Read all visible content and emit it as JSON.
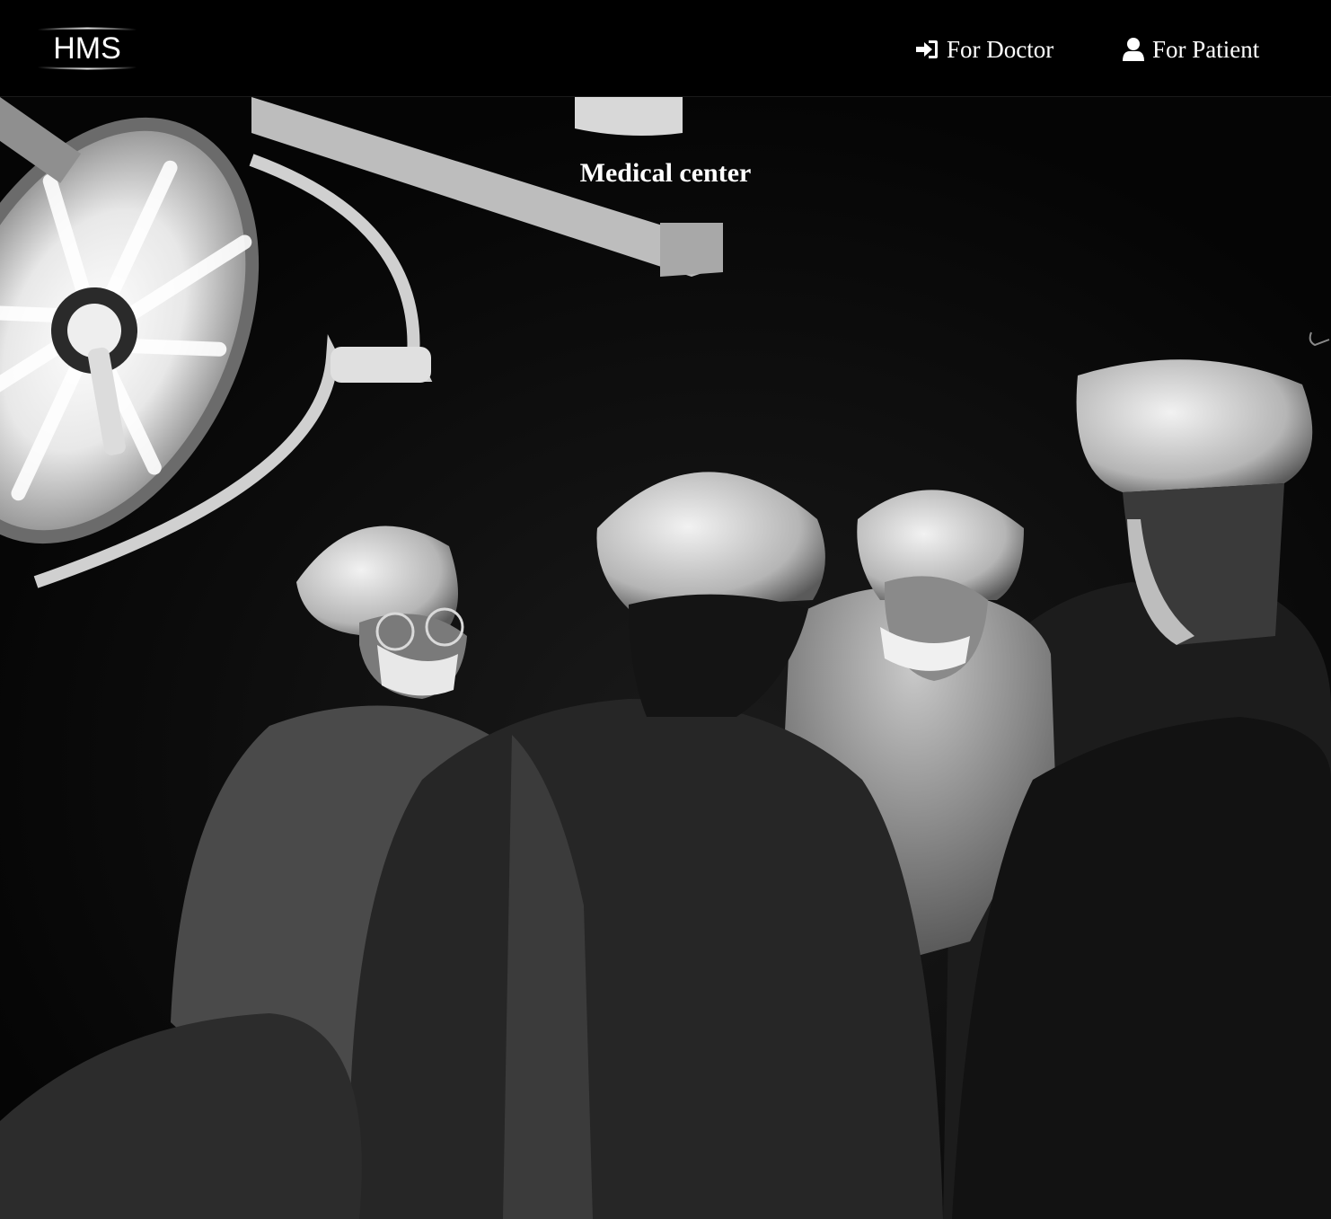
{
  "navbar": {
    "logo_text": "HMS",
    "links": [
      {
        "label": "For Doctor",
        "icon": "sign-in-icon"
      },
      {
        "label": "For Patient",
        "icon": "user-icon"
      }
    ]
  },
  "hero": {
    "title": "Medical center",
    "image": "surgical-team-black-and-white-photo"
  },
  "colors": {
    "navbar_bg": "#000000",
    "text": "#ffffff"
  }
}
